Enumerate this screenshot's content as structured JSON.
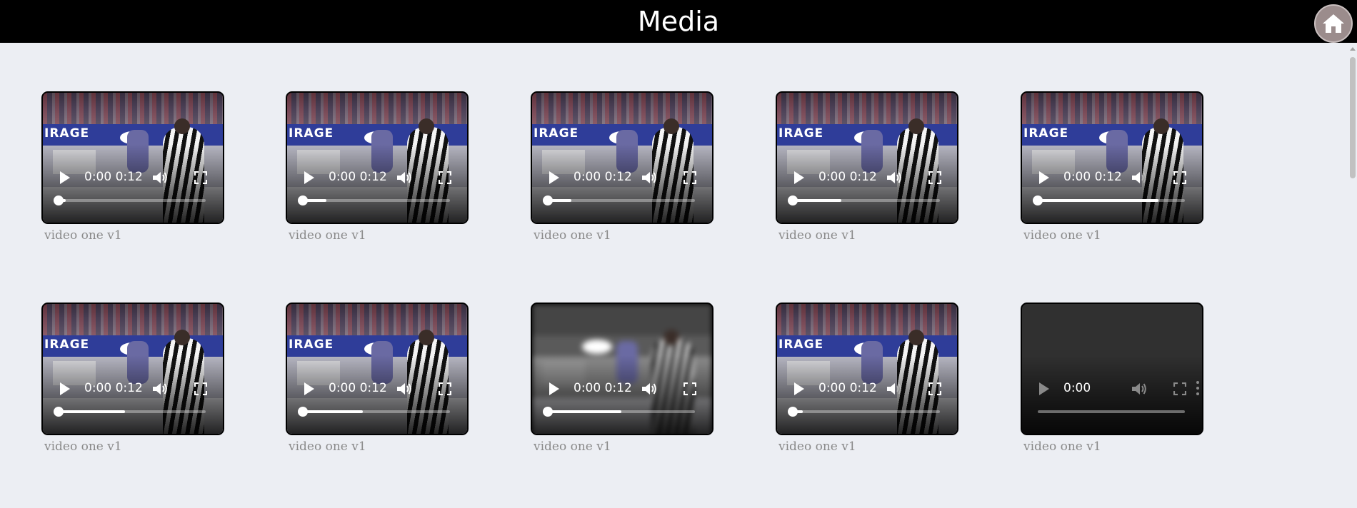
{
  "header": {
    "title": "Media",
    "home_icon": "home-icon"
  },
  "colors": {
    "header_bg": "#000000",
    "page_bg": "#eceef3",
    "caption": "#8a8a8a"
  },
  "videos": [
    {
      "caption": "video one v1",
      "current_time": "0:00",
      "duration": "0:12",
      "progress": 0.05,
      "scene": "hockey",
      "muted": false
    },
    {
      "caption": "video one v1",
      "current_time": "0:00",
      "duration": "0:12",
      "progress": 0.16,
      "scene": "hockey",
      "muted": false
    },
    {
      "caption": "video one v1",
      "current_time": "0:00",
      "duration": "0:12",
      "progress": 0.16,
      "scene": "hockey",
      "muted": false
    },
    {
      "caption": "video one v1",
      "current_time": "0:00",
      "duration": "0:12",
      "progress": 0.33,
      "scene": "hockey",
      "muted": false
    },
    {
      "caption": "video one v1",
      "current_time": "0:00",
      "duration": "0:12",
      "progress": 0.82,
      "scene": "hockey",
      "muted": true
    },
    {
      "caption": "video one v1",
      "current_time": "0:00",
      "duration": "0:12",
      "progress": 0.45,
      "scene": "hockey",
      "muted": false
    },
    {
      "caption": "video one v1",
      "current_time": "0:00",
      "duration": "0:12",
      "progress": 0.41,
      "scene": "hockey",
      "muted": false
    },
    {
      "caption": "video one v1",
      "current_time": "0:00",
      "duration": "0:12",
      "progress": 0.5,
      "scene": "blurred",
      "muted": false
    },
    {
      "caption": "video one v1",
      "current_time": "0:00",
      "duration": "0:12",
      "progress": 0.07,
      "scene": "hockey",
      "muted": true
    },
    {
      "caption": "video one v1",
      "current_time": "0:00",
      "duration": "",
      "progress": 0,
      "scene": "empty",
      "muted": true,
      "disabled": true
    }
  ]
}
